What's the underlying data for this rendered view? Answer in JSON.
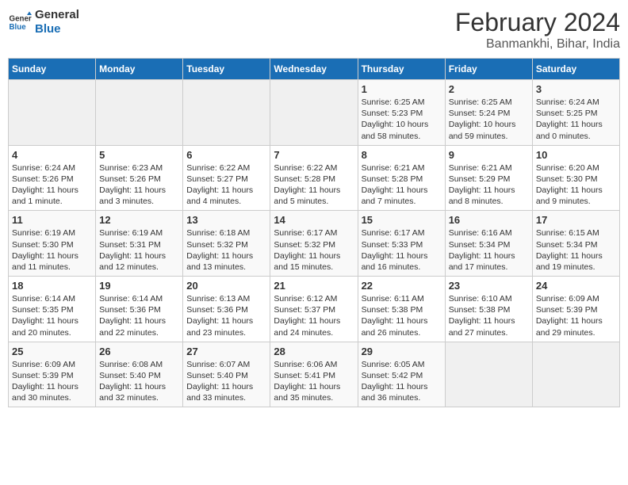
{
  "header": {
    "logo_line1": "General",
    "logo_line2": "Blue",
    "title": "February 2024",
    "subtitle": "Banmankhi, Bihar, India"
  },
  "days_of_week": [
    "Sunday",
    "Monday",
    "Tuesday",
    "Wednesday",
    "Thursday",
    "Friday",
    "Saturday"
  ],
  "weeks": [
    [
      {
        "day": "",
        "info": ""
      },
      {
        "day": "",
        "info": ""
      },
      {
        "day": "",
        "info": ""
      },
      {
        "day": "",
        "info": ""
      },
      {
        "day": "1",
        "info": "Sunrise: 6:25 AM\nSunset: 5:23 PM\nDaylight: 10 hours\nand 58 minutes."
      },
      {
        "day": "2",
        "info": "Sunrise: 6:25 AM\nSunset: 5:24 PM\nDaylight: 10 hours\nand 59 minutes."
      },
      {
        "day": "3",
        "info": "Sunrise: 6:24 AM\nSunset: 5:25 PM\nDaylight: 11 hours\nand 0 minutes."
      }
    ],
    [
      {
        "day": "4",
        "info": "Sunrise: 6:24 AM\nSunset: 5:26 PM\nDaylight: 11 hours\nand 1 minute."
      },
      {
        "day": "5",
        "info": "Sunrise: 6:23 AM\nSunset: 5:26 PM\nDaylight: 11 hours\nand 3 minutes."
      },
      {
        "day": "6",
        "info": "Sunrise: 6:22 AM\nSunset: 5:27 PM\nDaylight: 11 hours\nand 4 minutes."
      },
      {
        "day": "7",
        "info": "Sunrise: 6:22 AM\nSunset: 5:28 PM\nDaylight: 11 hours\nand 5 minutes."
      },
      {
        "day": "8",
        "info": "Sunrise: 6:21 AM\nSunset: 5:28 PM\nDaylight: 11 hours\nand 7 minutes."
      },
      {
        "day": "9",
        "info": "Sunrise: 6:21 AM\nSunset: 5:29 PM\nDaylight: 11 hours\nand 8 minutes."
      },
      {
        "day": "10",
        "info": "Sunrise: 6:20 AM\nSunset: 5:30 PM\nDaylight: 11 hours\nand 9 minutes."
      }
    ],
    [
      {
        "day": "11",
        "info": "Sunrise: 6:19 AM\nSunset: 5:30 PM\nDaylight: 11 hours\nand 11 minutes."
      },
      {
        "day": "12",
        "info": "Sunrise: 6:19 AM\nSunset: 5:31 PM\nDaylight: 11 hours\nand 12 minutes."
      },
      {
        "day": "13",
        "info": "Sunrise: 6:18 AM\nSunset: 5:32 PM\nDaylight: 11 hours\nand 13 minutes."
      },
      {
        "day": "14",
        "info": "Sunrise: 6:17 AM\nSunset: 5:32 PM\nDaylight: 11 hours\nand 15 minutes."
      },
      {
        "day": "15",
        "info": "Sunrise: 6:17 AM\nSunset: 5:33 PM\nDaylight: 11 hours\nand 16 minutes."
      },
      {
        "day": "16",
        "info": "Sunrise: 6:16 AM\nSunset: 5:34 PM\nDaylight: 11 hours\nand 17 minutes."
      },
      {
        "day": "17",
        "info": "Sunrise: 6:15 AM\nSunset: 5:34 PM\nDaylight: 11 hours\nand 19 minutes."
      }
    ],
    [
      {
        "day": "18",
        "info": "Sunrise: 6:14 AM\nSunset: 5:35 PM\nDaylight: 11 hours\nand 20 minutes."
      },
      {
        "day": "19",
        "info": "Sunrise: 6:14 AM\nSunset: 5:36 PM\nDaylight: 11 hours\nand 22 minutes."
      },
      {
        "day": "20",
        "info": "Sunrise: 6:13 AM\nSunset: 5:36 PM\nDaylight: 11 hours\nand 23 minutes."
      },
      {
        "day": "21",
        "info": "Sunrise: 6:12 AM\nSunset: 5:37 PM\nDaylight: 11 hours\nand 24 minutes."
      },
      {
        "day": "22",
        "info": "Sunrise: 6:11 AM\nSunset: 5:38 PM\nDaylight: 11 hours\nand 26 minutes."
      },
      {
        "day": "23",
        "info": "Sunrise: 6:10 AM\nSunset: 5:38 PM\nDaylight: 11 hours\nand 27 minutes."
      },
      {
        "day": "24",
        "info": "Sunrise: 6:09 AM\nSunset: 5:39 PM\nDaylight: 11 hours\nand 29 minutes."
      }
    ],
    [
      {
        "day": "25",
        "info": "Sunrise: 6:09 AM\nSunset: 5:39 PM\nDaylight: 11 hours\nand 30 minutes."
      },
      {
        "day": "26",
        "info": "Sunrise: 6:08 AM\nSunset: 5:40 PM\nDaylight: 11 hours\nand 32 minutes."
      },
      {
        "day": "27",
        "info": "Sunrise: 6:07 AM\nSunset: 5:40 PM\nDaylight: 11 hours\nand 33 minutes."
      },
      {
        "day": "28",
        "info": "Sunrise: 6:06 AM\nSunset: 5:41 PM\nDaylight: 11 hours\nand 35 minutes."
      },
      {
        "day": "29",
        "info": "Sunrise: 6:05 AM\nSunset: 5:42 PM\nDaylight: 11 hours\nand 36 minutes."
      },
      {
        "day": "",
        "info": ""
      },
      {
        "day": "",
        "info": ""
      }
    ]
  ]
}
